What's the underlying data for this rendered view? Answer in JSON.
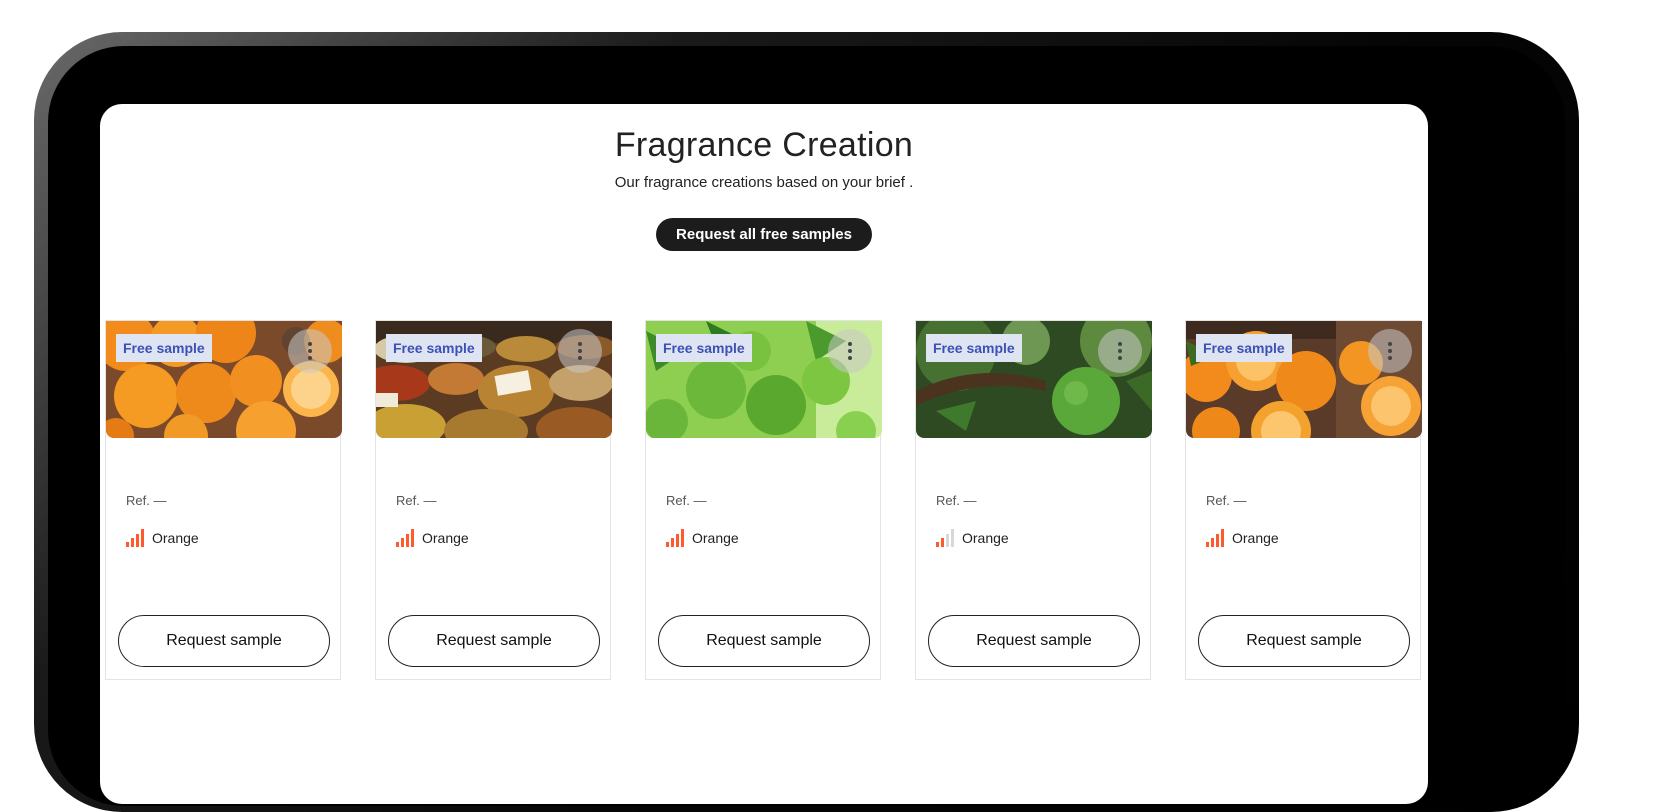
{
  "page": {
    "title": "Fragrance Creation",
    "subtitle": "Our fragrance creations based on your brief .",
    "request_all_label": "Request all free samples"
  },
  "cards": [
    {
      "badge": "Free sample",
      "ref": "Ref. —",
      "note": "Orange",
      "intensity": 4,
      "image": "oranges",
      "button": "Request sample"
    },
    {
      "badge": "Free sample",
      "ref": "Ref. —",
      "note": "Orange",
      "intensity": 4,
      "image": "spices",
      "button": "Request sample"
    },
    {
      "badge": "Free sample",
      "ref": "Ref. —",
      "note": "Orange",
      "intensity": 4,
      "image": "green-citrus",
      "button": "Request sample"
    },
    {
      "badge": "Free sample",
      "ref": "Ref. —",
      "note": "Orange",
      "intensity": 2,
      "image": "green-fruit-tree",
      "button": "Request sample"
    },
    {
      "badge": "Free sample",
      "ref": "Ref. —",
      "note": "Orange",
      "intensity": 4,
      "image": "tangerines",
      "button": "Request sample"
    }
  ],
  "colors": {
    "bar_active": "#ff5a2e",
    "bar_inactive": "#d8d8d8",
    "badge_bg": "#dfe4f3",
    "badge_text": "#3d51b5"
  }
}
